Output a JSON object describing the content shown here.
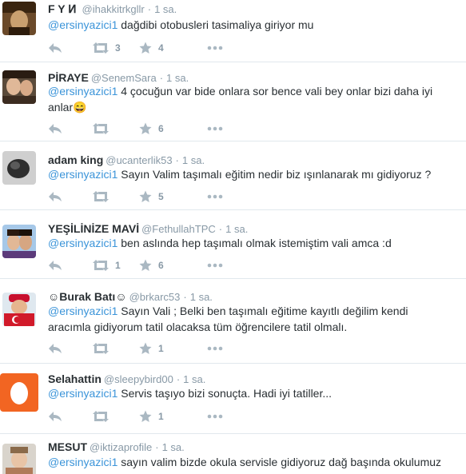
{
  "colors": {
    "link": "#3b94d9",
    "muted": "#8899a6",
    "icon": "#aab8c2",
    "divider": "#e1e8ed"
  },
  "tweets": [
    {
      "name": "F Y Ͷ ",
      "handle": "@ihakkitrkgllr",
      "dot": "·",
      "time": "1 sa.",
      "mention": "@ersinyazici1",
      "text": " dağdibi otobusleri tasimaliya giriyor mu",
      "retweets": "3",
      "favorites": "4"
    },
    {
      "name": "PİRAYE",
      "handle": "@SenemSara",
      "dot": "·",
      "time": "1 sa.",
      "mention": "@ersinyazici1",
      "text": " 4 çocuğun var bide onlara sor bence vali bey onlar bizi daha iyi anlar😄",
      "retweets": "",
      "favorites": "6"
    },
    {
      "name": "adam king",
      "handle": "@ucanterlik53",
      "dot": "·",
      "time": "1 sa.",
      "mention": "@ersinyazici1",
      "text": " Sayın Valim taşımalı eğitim nedir biz ışınlanarak mı gidiyoruz ?",
      "retweets": "",
      "favorites": "5"
    },
    {
      "name": "YEŞİLİNİZE MAVİ",
      "handle": "@FethullahTPC",
      "dot": "·",
      "time": "1 sa.",
      "mention": "@ersinyazici1",
      "text": " ben aslında hep taşımalı olmak istemiştim vali amca :d",
      "retweets": "1",
      "favorites": "6"
    },
    {
      "name": "☺Burak Batı☺",
      "handle": "@brkarc53",
      "dot": "·",
      "time": "1 sa.",
      "mention": "@ersinyazici1",
      "text": " Sayın Vali ; Belki ben taşımalı eğitime kayıtlı değilim kendi aracımla gidiyorum tatil olacaksa tüm öğrencilere tatil olmalı.",
      "retweets": "",
      "favorites": "1"
    },
    {
      "name": "Selahattin",
      "handle": "@sleepybird00",
      "dot": "·",
      "time": "1 sa.",
      "mention": "@ersinyazici1",
      "text": " Servis taşıyo bizi sonuçta. Hadi iyi tatiller...",
      "retweets": "",
      "favorites": "1"
    },
    {
      "name": "MESUT",
      "handle": "@iktizaprofile",
      "dot": "·",
      "time": "1 sa.",
      "mention": "@ersinyazici1",
      "text": " sayın valim bizde okula servisle gidiyoruz dağ başında okulumuz kaldığı",
      "retweets": "",
      "favorites": ""
    }
  ]
}
